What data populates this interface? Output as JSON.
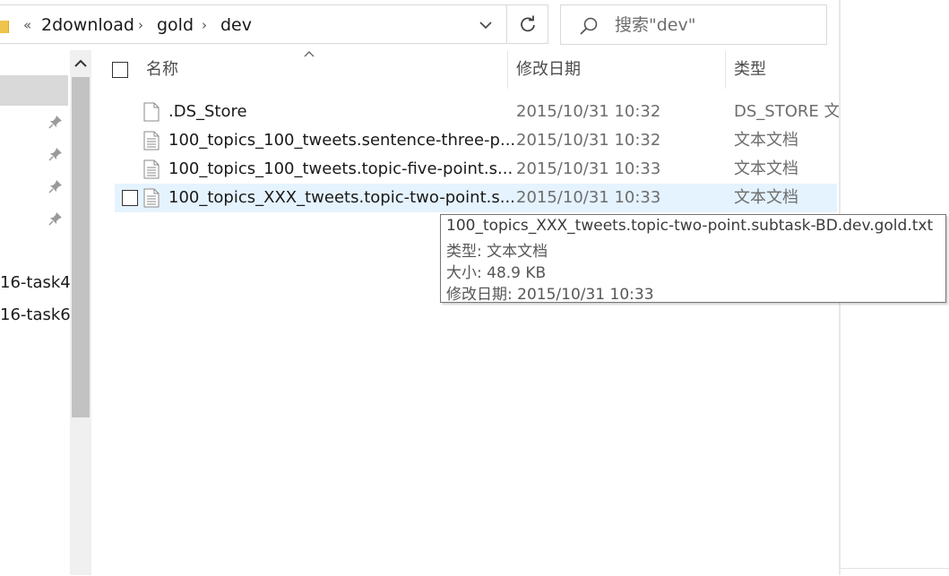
{
  "address_bar": {
    "overflow_glyph": "«",
    "crumbs": [
      "2download",
      "gold",
      "dev"
    ],
    "separator": "›"
  },
  "search": {
    "placeholder": "搜索\"dev\""
  },
  "columns": {
    "name": "名称",
    "date": "修改日期",
    "type": "类型"
  },
  "nav": {
    "items": [
      "16-task4",
      "16-task6"
    ]
  },
  "files": [
    {
      "name": ".DS_Store",
      "date": "2015/10/31 10:32",
      "type": "DS_STORE 文件"
    },
    {
      "name": "100_topics_100_tweets.sentence-three-p...",
      "date": "2015/10/31 10:32",
      "type": "文本文档"
    },
    {
      "name": "100_topics_100_tweets.topic-five-point.s...",
      "date": "2015/10/31 10:33",
      "type": "文本文档"
    },
    {
      "name": "100_topics_XXX_tweets.topic-two-point.s...",
      "date": "2015/10/31 10:33",
      "type": "文本文档"
    }
  ],
  "tooltip": {
    "filename": "100_topics_XXX_tweets.topic-two-point.subtask-BD.dev.gold.txt",
    "type_line": "类型: 文本文档",
    "size_line": "大小: 48.9 KB",
    "date_line": "修改日期: 2015/10/31 10:33"
  },
  "icons": {
    "refresh": "refresh-icon",
    "search": "search-icon",
    "pin": "pin-icon",
    "file": "text-file-icon",
    "folder": "folder-icon"
  },
  "colors": {
    "hover_row": "#e5f3ff",
    "scroll_thumb": "#c2c2c2",
    "border": "#d9d9d9"
  }
}
